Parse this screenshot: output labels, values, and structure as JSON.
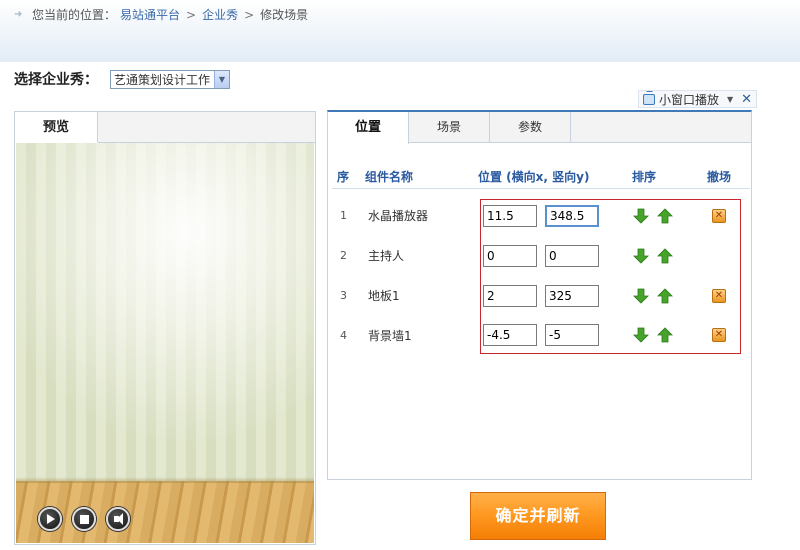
{
  "breadcrumb": {
    "prefix": "您当前的位置：",
    "items": [
      "易站通平台",
      "企业秀",
      "修改场景"
    ],
    "separator": ">"
  },
  "selector": {
    "label": "选择企业秀：",
    "value": "艺通策划设计工作"
  },
  "mini_player": {
    "label": "小窗口播放",
    "icon": "tv-icon"
  },
  "preview": {
    "tab_label": "预览",
    "controls": [
      "play-icon",
      "stop-icon",
      "volume-icon"
    ]
  },
  "editor": {
    "tabs": [
      {
        "label": "位置",
        "active": true
      },
      {
        "label": "场景",
        "active": false
      },
      {
        "label": "参数",
        "active": false
      }
    ],
    "columns": {
      "index": "序",
      "name": "组件名称",
      "position": "位置 (横向x, 竖向y)",
      "order": "排序",
      "remove": "撤场"
    },
    "rows": [
      {
        "index": "1",
        "name": "水晶播放器",
        "x": "11.5",
        "y": "348.5",
        "removable": true
      },
      {
        "index": "2",
        "name": "主持人",
        "x": "0",
        "y": "0",
        "removable": false
      },
      {
        "index": "3",
        "name": "地板1",
        "x": "2",
        "y": "325",
        "removable": true
      },
      {
        "index": "4",
        "name": "背景墙1",
        "x": "-4.5",
        "y": "-5",
        "removable": true
      }
    ]
  },
  "confirm_button": "确定并刷新",
  "colors": {
    "accent_blue": "#2a5aa0",
    "confirm_orange": "#ff9a22",
    "highlight_red": "#c8252c",
    "arrow_green": "#3f9a2a"
  }
}
